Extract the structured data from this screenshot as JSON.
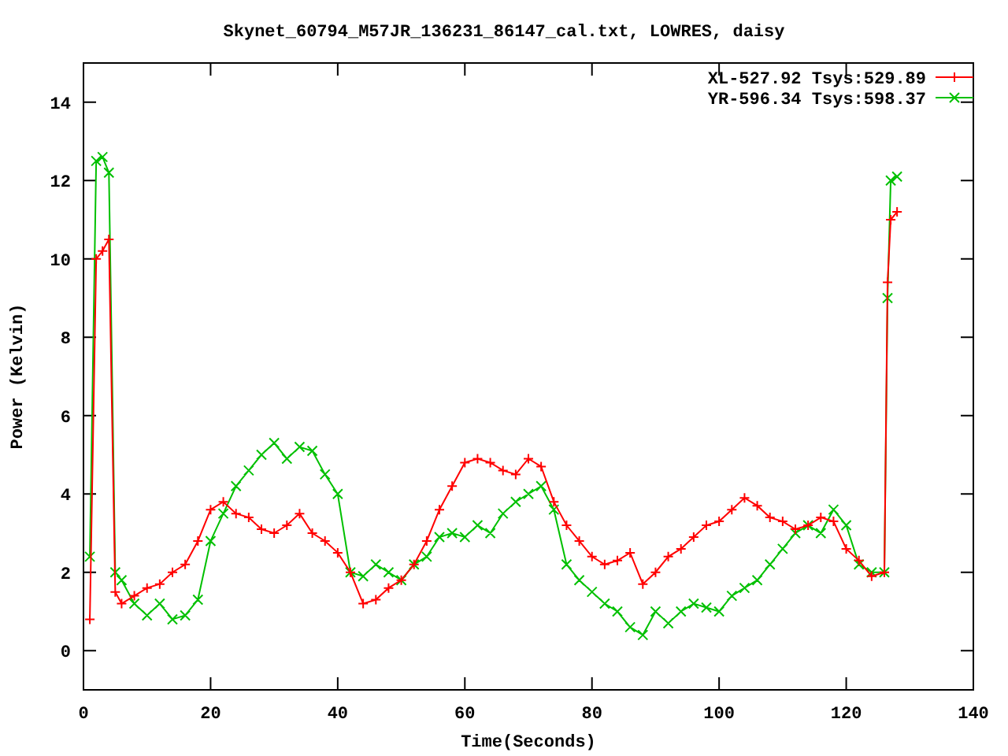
{
  "chart_data": {
    "type": "line",
    "title": "Skynet_60794_M57JR_136231_86147_cal.txt, LOWRES, daisy",
    "xlabel": "Time(Seconds)",
    "ylabel": "Power (Kelvin)",
    "x": [
      1,
      2,
      3,
      4,
      5,
      6,
      8,
      10,
      12,
      14,
      16,
      18,
      20,
      22,
      24,
      26,
      28,
      30,
      32,
      34,
      36,
      38,
      40,
      42,
      44,
      46,
      48,
      50,
      52,
      54,
      56,
      58,
      60,
      62,
      64,
      66,
      68,
      70,
      72,
      74,
      76,
      78,
      80,
      82,
      84,
      86,
      88,
      90,
      92,
      94,
      96,
      98,
      100,
      102,
      104,
      106,
      108,
      110,
      112,
      114,
      116,
      118,
      120,
      122,
      124,
      126,
      126.5,
      127,
      128
    ],
    "series": [
      {
        "name": "XL-527.92 Tsys:529.89",
        "color": "#ff0000",
        "marker": "plus",
        "values": [
          0.8,
          10,
          10.2,
          10.5,
          1.5,
          1.2,
          1.4,
          1.6,
          1.7,
          2,
          2.2,
          2.8,
          3.6,
          3.8,
          3.5,
          3.4,
          3.1,
          3,
          3.2,
          3.5,
          3,
          2.8,
          2.5,
          2,
          1.2,
          1.3,
          1.6,
          1.8,
          2.2,
          2.8,
          3.6,
          4.2,
          4.8,
          4.9,
          4.8,
          4.6,
          4.5,
          4.9,
          4.7,
          3.8,
          3.2,
          2.8,
          2.4,
          2.2,
          2.3,
          2.5,
          1.7,
          2,
          2.4,
          2.6,
          2.9,
          3.2,
          3.3,
          3.6,
          3.9,
          3.7,
          3.4,
          3.3,
          3.1,
          3.2,
          3.4,
          3.3,
          2.6,
          2.3,
          1.9,
          2,
          9.4,
          11,
          11.2
        ]
      },
      {
        "name": "YR-596.34 Tsys:598.37",
        "color": "#00c000",
        "marker": "x",
        "values": [
          2.4,
          12.5,
          12.6,
          12.2,
          2,
          1.8,
          1.2,
          0.9,
          1.2,
          0.8,
          0.9,
          1.3,
          2.8,
          3.5,
          4.2,
          4.6,
          5,
          5.3,
          4.9,
          5.2,
          5.1,
          4.5,
          4,
          2,
          1.9,
          2.2,
          2,
          1.8,
          2.2,
          2.4,
          2.9,
          3,
          2.9,
          3.2,
          3,
          3.5,
          3.8,
          4,
          4.2,
          3.6,
          2.2,
          1.8,
          1.5,
          1.2,
          1,
          0.6,
          0.4,
          1,
          0.7,
          1,
          1.2,
          1.1,
          1,
          1.4,
          1.6,
          1.8,
          2.2,
          2.6,
          3,
          3.2,
          3,
          3.6,
          3.2,
          2.2,
          2,
          2,
          9,
          12,
          12.1
        ]
      }
    ],
    "legend": true,
    "xlim": [
      0,
      140
    ],
    "ylim": [
      -1,
      15
    ],
    "xticks": [
      0,
      20,
      40,
      60,
      80,
      100,
      120,
      140
    ],
    "yticks": [
      0,
      2,
      4,
      6,
      8,
      10,
      12,
      14
    ]
  }
}
